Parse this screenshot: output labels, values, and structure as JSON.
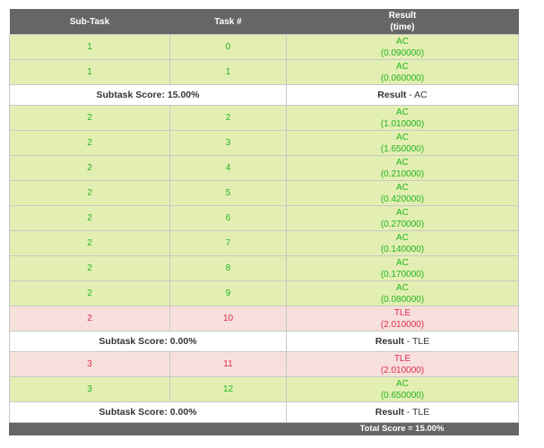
{
  "header": {
    "subtask": "Sub-Task",
    "task": "Task #",
    "result": "Result",
    "result_sub": "(time)"
  },
  "colors": {
    "accepted_bg": "#e3efb2",
    "accepted_text": "#22b422",
    "failed_bg": "#f7e0dc",
    "failed_text": "#dc2a52",
    "header_bg": "#666666"
  },
  "groups": [
    {
      "rows": [
        {
          "subtask": "1",
          "task": "0",
          "verdict": "AC",
          "time": "(0.090000)"
        },
        {
          "subtask": "1",
          "task": "1",
          "verdict": "AC",
          "time": "(0.060000)"
        }
      ],
      "score_label": "Subtask Score: 15.00%",
      "result_label": "Result",
      "result_sep": " - ",
      "result_value": "AC"
    },
    {
      "rows": [
        {
          "subtask": "2",
          "task": "2",
          "verdict": "AC",
          "time": "(1.010000)"
        },
        {
          "subtask": "2",
          "task": "3",
          "verdict": "AC",
          "time": "(1.650000)"
        },
        {
          "subtask": "2",
          "task": "4",
          "verdict": "AC",
          "time": "(0.210000)"
        },
        {
          "subtask": "2",
          "task": "5",
          "verdict": "AC",
          "time": "(0.420000)"
        },
        {
          "subtask": "2",
          "task": "6",
          "verdict": "AC",
          "time": "(0.270000)"
        },
        {
          "subtask": "2",
          "task": "7",
          "verdict": "AC",
          "time": "(0.140000)"
        },
        {
          "subtask": "2",
          "task": "8",
          "verdict": "AC",
          "time": "(0.170000)"
        },
        {
          "subtask": "2",
          "task": "9",
          "verdict": "AC",
          "time": "(0.080000)"
        },
        {
          "subtask": "2",
          "task": "10",
          "verdict": "TLE",
          "time": "(2.010000)"
        }
      ],
      "score_label": "Subtask Score: 0.00%",
      "result_label": "Result",
      "result_sep": " - ",
      "result_value": "TLE"
    },
    {
      "rows": [
        {
          "subtask": "3",
          "task": "11",
          "verdict": "TLE",
          "time": "(2.010000)"
        },
        {
          "subtask": "3",
          "task": "12",
          "verdict": "AC",
          "time": "(0.650000)"
        }
      ],
      "score_label": "Subtask Score: 0.00%",
      "result_label": "Result",
      "result_sep": " - ",
      "result_value": "TLE"
    }
  ],
  "total": "Total Score = 15.00%"
}
